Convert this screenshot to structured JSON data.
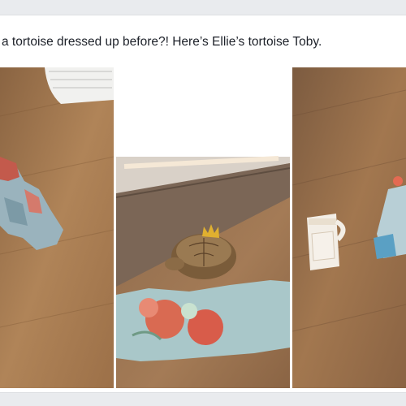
{
  "post": {
    "text": "a tortoise dressed up before?! Here’s Ellie’s tortoise Toby."
  },
  "photos": [
    {
      "label": "photo-1",
      "subject": "floral cloth on wooden floor"
    },
    {
      "label": "photo-2",
      "subject": "tortoise wearing crown on floral blanket"
    },
    {
      "label": "photo-3",
      "subject": "mug and cloth on wooden floor"
    }
  ],
  "colors": {
    "page_bg": "#e9ebee",
    "card_bg": "#ffffff",
    "text": "#1d2129",
    "floor": "#a57a52"
  }
}
